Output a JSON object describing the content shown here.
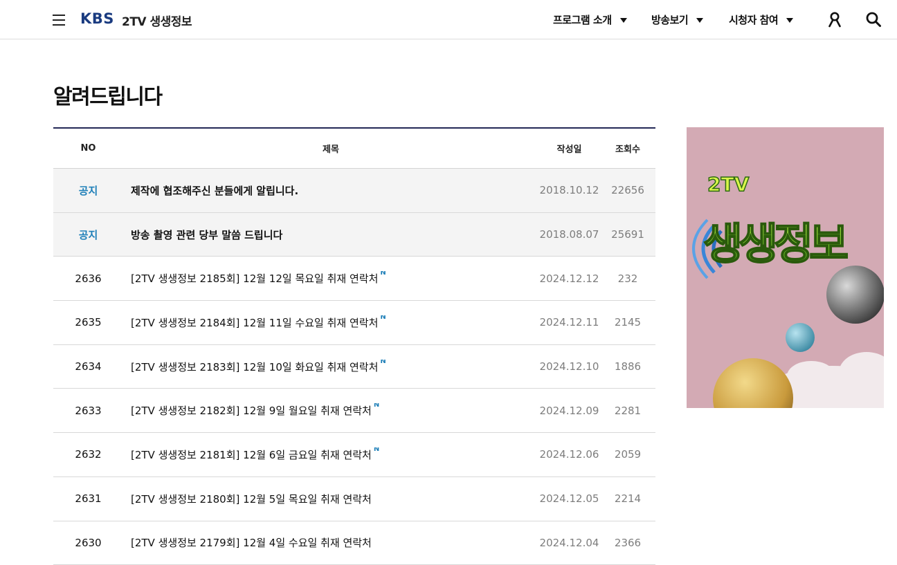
{
  "header": {
    "brand": "KBS",
    "program": "2TV 생생정보",
    "menu": [
      {
        "label": "프로그램 소개"
      },
      {
        "label": "방송보기"
      },
      {
        "label": "시청자 참여"
      }
    ]
  },
  "page": {
    "title": "알려드립니다"
  },
  "board": {
    "columns": {
      "no": "NO",
      "title": "제목",
      "date": "작성일",
      "views": "조회수"
    },
    "rows": [
      {
        "no": "공지",
        "title": "제작에 협조해주신 분들에게 알립니다.",
        "date": "2018.10.12",
        "views": "22656",
        "new": ""
      },
      {
        "no": "공지",
        "title": "방송 촬영 관련 당부 말씀 드립니다",
        "date": "2018.08.07",
        "views": "25691",
        "new": ""
      },
      {
        "no": "2636",
        "title": "[2TV 생생정보 2185회] 12월 12일 목요일 취재 연락처",
        "date": "2024.12.12",
        "views": "232",
        "new": "N"
      },
      {
        "no": "2635",
        "title": "[2TV 생생정보 2184회] 12월 11일 수요일 취재 연락처",
        "date": "2024.12.11",
        "views": "2145",
        "new": "N"
      },
      {
        "no": "2634",
        "title": "[2TV 생생정보 2183회] 12월 10일 화요일 취재 연락처",
        "date": "2024.12.10",
        "views": "1886",
        "new": "N"
      },
      {
        "no": "2633",
        "title": "[2TV 생생정보 2182회] 12월 9일 월요일 취재 연락처",
        "date": "2024.12.09",
        "views": "2281",
        "new": "N"
      },
      {
        "no": "2632",
        "title": "[2TV 생생정보 2181회] 12월 6일 금요일 취재 연락처",
        "date": "2024.12.06",
        "views": "2059",
        "new": "N"
      },
      {
        "no": "2631",
        "title": "[2TV 생생정보 2180회] 12월 5일 목요일 취재 연락처",
        "date": "2024.12.05",
        "views": "2214",
        "new": ""
      },
      {
        "no": "2630",
        "title": "[2TV 생생정보 2179회] 12월 4일 수요일 취재 연락처",
        "date": "2024.12.04",
        "views": "2366",
        "new": ""
      }
    ]
  },
  "banner": {
    "badge": "2TV",
    "logo_text": "생생정보",
    "background_color": "#d3aab4"
  },
  "colors": {
    "brand_navy": "#1a3b80",
    "board_rule": "#232856",
    "notice_blue": "#1e7fb8",
    "muted_gray": "#7d7d7d"
  },
  "icons": {
    "menu": "hamburger-icon",
    "user": "user-icon",
    "search": "search-icon",
    "dropdown": "caret-down-icon"
  }
}
